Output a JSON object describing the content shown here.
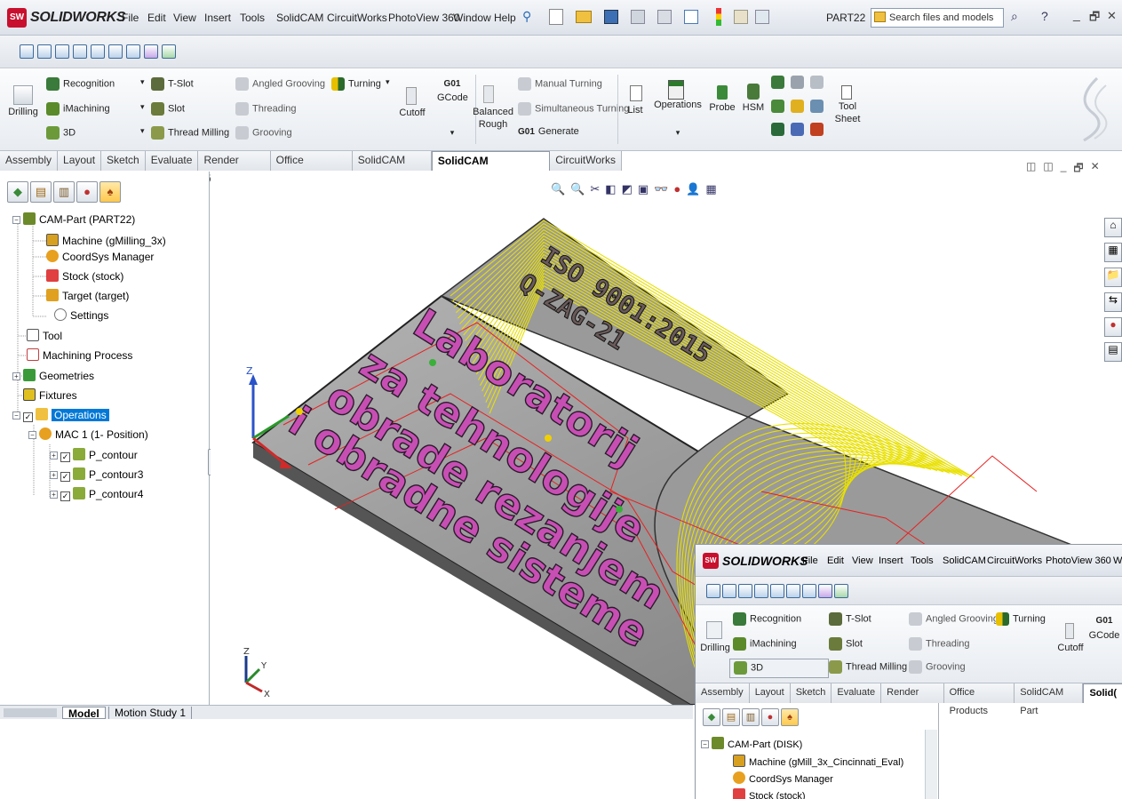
{
  "title_bar": {
    "logo_badge": "SW",
    "logo_text": "SOLIDWORKS",
    "menus": [
      "File",
      "Edit",
      "View",
      "Insert",
      "Tools",
      "SolidCAM",
      "CircuitWorks",
      "PhotoView 360",
      "Window",
      "Help"
    ],
    "doc_name": "PART22",
    "search_placeholder": "Search files and models",
    "help_glyph": "?",
    "window_controls": [
      "_",
      "🗗",
      "✕"
    ]
  },
  "command_manager": {
    "col1": [
      "Drilling"
    ],
    "col2": [
      "Recognition",
      "iMachining",
      "3D"
    ],
    "col3": [
      "T-Slot",
      "Slot",
      "Thread Milling"
    ],
    "col4": [
      "Angled Grooving",
      "Threading",
      "Grooving"
    ],
    "turning": "Turning",
    "cutoff": "Cutoff",
    "gcode_tag": "G01",
    "gcode": "GCode",
    "balanced_rough": [
      "Balanced",
      "Rough"
    ],
    "manual_turning": "Manual Turning",
    "simultaneous_turning": "Simultaneous Turning",
    "generate_tag": "G01",
    "generate": "Generate",
    "list": "List",
    "operations": "Operations",
    "probe": "Probe",
    "hsm": "HSM",
    "tool_sheet": [
      "Tool",
      "Sheet"
    ],
    "dropdown_glyph": "▾"
  },
  "tabs": [
    "Assembly",
    "Layout",
    "Sketch",
    "Evaluate",
    "Render Tools",
    "Office Products",
    "SolidCAM Part",
    "SolidCAM Operations",
    "CircuitWorks"
  ],
  "active_tab": "SolidCAM Operations",
  "tree": {
    "root": "CAM-Part (PART22)",
    "children": [
      "Machine (gMilling_3x)",
      "CoordSys Manager",
      "Stock (stock)",
      "Target (target)",
      "Settings"
    ],
    "tool": "Tool",
    "machining_process": "Machining Process",
    "geometries": "Geometries",
    "fixtures": "Fixtures",
    "operations": "Operations",
    "mac": "MAC 1 (1- Position)",
    "ops": [
      "P_contour",
      "P_contour3",
      "P_contour4"
    ],
    "expand_minus": "−",
    "expand_plus": "+",
    "check": "✓"
  },
  "viewport": {
    "text_lines": [
      "Laboratorij",
      "za tehnologije",
      "obrade rezanjem",
      "i obradne sisteme"
    ],
    "plate_text": [
      "ISO 9001:2015",
      "Q-ZAG-21"
    ],
    "axis_z": "Z",
    "axis_y": "Y",
    "axis_x": "X",
    "view_icons": [
      "🔍",
      "🔍",
      "✂",
      "◧",
      "◩",
      "▣",
      "👓",
      "●",
      "👤",
      "▦"
    ],
    "window_controls": [
      "◫",
      "◫",
      "_",
      "🗗",
      "✕"
    ],
    "task_pane_icons": [
      "⌂",
      "▦",
      "📁",
      "⇆",
      "●",
      "▤"
    ]
  },
  "bottom_tabs": [
    "Model",
    "Motion Study 1"
  ],
  "inset": {
    "menus": [
      "File",
      "Edit",
      "View",
      "Insert",
      "Tools",
      "SolidCAM",
      "CircuitWorks",
      "PhotoView 360",
      "W"
    ],
    "col1": [
      "Drilling"
    ],
    "col2": [
      "Recognition",
      "iMachining",
      "3D"
    ],
    "col3": [
      "T-Slot",
      "Slot",
      "Thread Milling"
    ],
    "col4": [
      "Angled Grooving",
      "Threading",
      "Grooving"
    ],
    "turning": "Turning",
    "cutoff": "Cutoff",
    "gcode_tag": "G01",
    "gcode": "GCode",
    "tabs": [
      "Assembly",
      "Layout",
      "Sketch",
      "Evaluate",
      "Render Tools",
      "Office Products",
      "SolidCAM Part",
      "Solid("
    ],
    "tree_root": "CAM-Part (DISK)",
    "tree_children": [
      "Machine (gMill_3x_Cincinnati_Eval)",
      "CoordSys Manager",
      "Stock (stock)"
    ]
  },
  "colors": {
    "accent": "#0078d7",
    "text_fill": "#c74fb4",
    "toolpath_yellow": "#e8e000",
    "rapid_red": "#e82020",
    "plate_gray": "#8d8d8d"
  }
}
